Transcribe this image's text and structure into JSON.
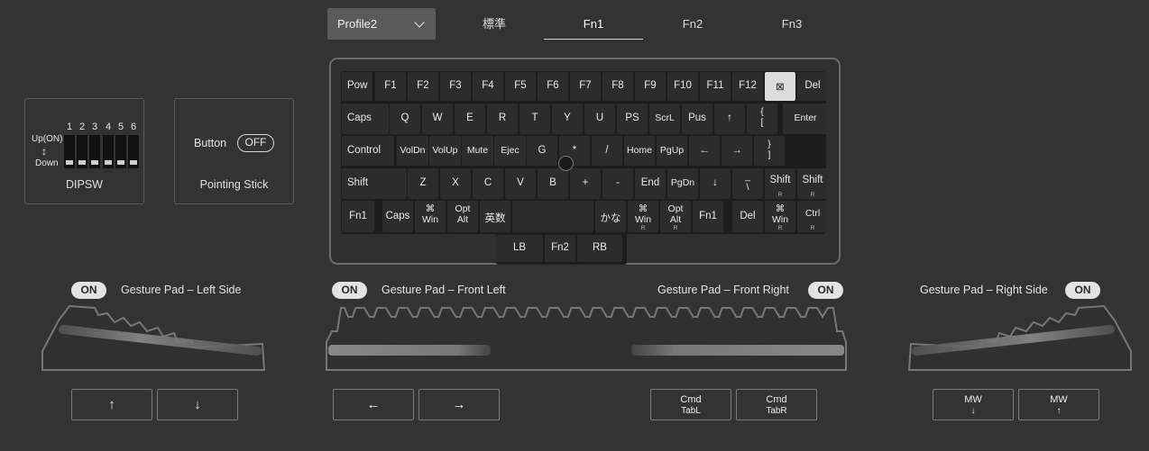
{
  "profile": {
    "selected": "Profile2"
  },
  "tabs": [
    {
      "label": "標準",
      "active": false
    },
    {
      "label": "Fn1",
      "active": true
    },
    {
      "label": "Fn2",
      "active": false
    },
    {
      "label": "Fn3",
      "active": false
    }
  ],
  "dipsw": {
    "up_label": "Up(ON)",
    "arrow": "↕",
    "down_label": "Down",
    "numbers": [
      "1",
      "2",
      "3",
      "4",
      "5",
      "6"
    ],
    "states": [
      "off",
      "off",
      "off",
      "off",
      "off",
      "off"
    ],
    "caption": "DIPSW"
  },
  "pointing_stick": {
    "button_label": "Button",
    "toggle": "OFF",
    "caption": "Pointing Stick"
  },
  "keyboard": {
    "row1": [
      "Pow",
      "F1",
      "F2",
      "F3",
      "F4",
      "F5",
      "F6",
      "F7",
      "F8",
      "F9",
      "F10",
      "F11",
      "F12",
      "⊠",
      "Del"
    ],
    "row2": [
      "Caps",
      "Q",
      "W",
      "E",
      "R",
      "T",
      "Y",
      "U",
      "PS",
      "ScrL",
      "Pus",
      "↑",
      "{\n[",
      "Enter"
    ],
    "row3": [
      "Control",
      "VolDn",
      "VolUp",
      "Mute",
      "Ejec",
      "G",
      "*",
      "/",
      "Home",
      "PgUp",
      "←",
      "→",
      "}\n]"
    ],
    "row4": [
      "Shift",
      "Z",
      "X",
      "C",
      "V",
      "B",
      "+",
      "-",
      "End",
      "PgDn",
      "↓",
      "_\n\\",
      "Shift",
      "Shift"
    ],
    "row4_subs": [
      "",
      "",
      "",
      "",
      "",
      "",
      "",
      "",
      "",
      "",
      "",
      "",
      "R",
      "R"
    ],
    "row5": [
      "Fn1",
      "Caps",
      "⌘\nWin",
      "Opt\nAlt",
      "英数",
      "",
      "かな",
      "⌘\nWin",
      "Opt\nAlt",
      "Fn1",
      "Del",
      "⌘\nWin",
      "Ctrl"
    ],
    "row5_subs": [
      "",
      "",
      "",
      "",
      "",
      "",
      "",
      "R",
      "R",
      "",
      "",
      "R",
      "R"
    ],
    "thumb": [
      "LB",
      "Fn2",
      "RB"
    ]
  },
  "gesture_pads": {
    "left_side": {
      "state": "ON",
      "label": "Gesture Pad – Left Side"
    },
    "front_left": {
      "state": "ON",
      "label": "Gesture Pad – Front Left"
    },
    "front_right": {
      "state": "ON",
      "label": "Gesture Pad – Front Right"
    },
    "right_side": {
      "state": "ON",
      "label": "Gesture Pad – Right Side"
    }
  },
  "actions": {
    "left_side": [
      {
        "l1": "↑"
      },
      {
        "l1": "↓"
      }
    ],
    "front_left": [
      {
        "l1": "←"
      },
      {
        "l1": "→"
      }
    ],
    "front_right": [
      {
        "l1": "Cmd",
        "l2": "TabL"
      },
      {
        "l1": "Cmd",
        "l2": "TabR"
      }
    ],
    "right_side": [
      {
        "l1": "MW",
        "l2": "↓"
      },
      {
        "l1": "MW",
        "l2": "↑"
      }
    ]
  },
  "colors": {
    "background": "#333333",
    "selected_key": "#dcdcdc",
    "pill": "#e3e3e3"
  }
}
